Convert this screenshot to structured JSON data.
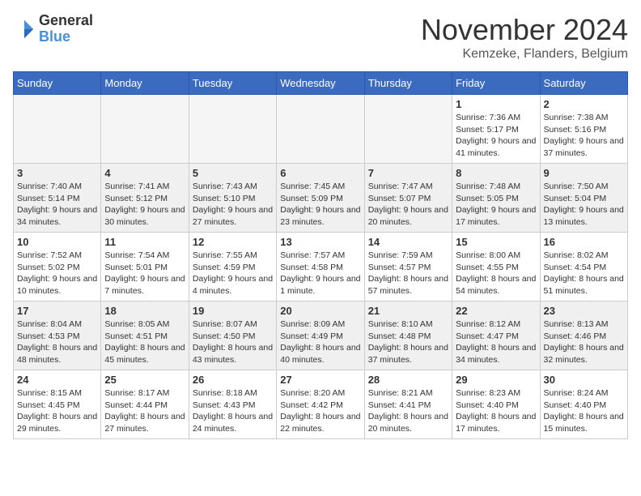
{
  "logo": {
    "general": "General",
    "blue": "Blue"
  },
  "header": {
    "month": "November 2024",
    "location": "Kemzeke, Flanders, Belgium"
  },
  "weekdays": [
    "Sunday",
    "Monday",
    "Tuesday",
    "Wednesday",
    "Thursday",
    "Friday",
    "Saturday"
  ],
  "weeks": [
    [
      {
        "day": "",
        "info": "",
        "empty": true
      },
      {
        "day": "",
        "info": "",
        "empty": true
      },
      {
        "day": "",
        "info": "",
        "empty": true
      },
      {
        "day": "",
        "info": "",
        "empty": true
      },
      {
        "day": "",
        "info": "",
        "empty": true
      },
      {
        "day": "1",
        "info": "Sunrise: 7:36 AM\nSunset: 5:17 PM\nDaylight: 9 hours and 41 minutes."
      },
      {
        "day": "2",
        "info": "Sunrise: 7:38 AM\nSunset: 5:16 PM\nDaylight: 9 hours and 37 minutes."
      }
    ],
    [
      {
        "day": "3",
        "info": "Sunrise: 7:40 AM\nSunset: 5:14 PM\nDaylight: 9 hours and 34 minutes."
      },
      {
        "day": "4",
        "info": "Sunrise: 7:41 AM\nSunset: 5:12 PM\nDaylight: 9 hours and 30 minutes."
      },
      {
        "day": "5",
        "info": "Sunrise: 7:43 AM\nSunset: 5:10 PM\nDaylight: 9 hours and 27 minutes."
      },
      {
        "day": "6",
        "info": "Sunrise: 7:45 AM\nSunset: 5:09 PM\nDaylight: 9 hours and 23 minutes."
      },
      {
        "day": "7",
        "info": "Sunrise: 7:47 AM\nSunset: 5:07 PM\nDaylight: 9 hours and 20 minutes."
      },
      {
        "day": "8",
        "info": "Sunrise: 7:48 AM\nSunset: 5:05 PM\nDaylight: 9 hours and 17 minutes."
      },
      {
        "day": "9",
        "info": "Sunrise: 7:50 AM\nSunset: 5:04 PM\nDaylight: 9 hours and 13 minutes."
      }
    ],
    [
      {
        "day": "10",
        "info": "Sunrise: 7:52 AM\nSunset: 5:02 PM\nDaylight: 9 hours and 10 minutes."
      },
      {
        "day": "11",
        "info": "Sunrise: 7:54 AM\nSunset: 5:01 PM\nDaylight: 9 hours and 7 minutes."
      },
      {
        "day": "12",
        "info": "Sunrise: 7:55 AM\nSunset: 4:59 PM\nDaylight: 9 hours and 4 minutes."
      },
      {
        "day": "13",
        "info": "Sunrise: 7:57 AM\nSunset: 4:58 PM\nDaylight: 9 hours and 1 minute."
      },
      {
        "day": "14",
        "info": "Sunrise: 7:59 AM\nSunset: 4:57 PM\nDaylight: 8 hours and 57 minutes."
      },
      {
        "day": "15",
        "info": "Sunrise: 8:00 AM\nSunset: 4:55 PM\nDaylight: 8 hours and 54 minutes."
      },
      {
        "day": "16",
        "info": "Sunrise: 8:02 AM\nSunset: 4:54 PM\nDaylight: 8 hours and 51 minutes."
      }
    ],
    [
      {
        "day": "17",
        "info": "Sunrise: 8:04 AM\nSunset: 4:53 PM\nDaylight: 8 hours and 48 minutes."
      },
      {
        "day": "18",
        "info": "Sunrise: 8:05 AM\nSunset: 4:51 PM\nDaylight: 8 hours and 45 minutes."
      },
      {
        "day": "19",
        "info": "Sunrise: 8:07 AM\nSunset: 4:50 PM\nDaylight: 8 hours and 43 minutes."
      },
      {
        "day": "20",
        "info": "Sunrise: 8:09 AM\nSunset: 4:49 PM\nDaylight: 8 hours and 40 minutes."
      },
      {
        "day": "21",
        "info": "Sunrise: 8:10 AM\nSunset: 4:48 PM\nDaylight: 8 hours and 37 minutes."
      },
      {
        "day": "22",
        "info": "Sunrise: 8:12 AM\nSunset: 4:47 PM\nDaylight: 8 hours and 34 minutes."
      },
      {
        "day": "23",
        "info": "Sunrise: 8:13 AM\nSunset: 4:46 PM\nDaylight: 8 hours and 32 minutes."
      }
    ],
    [
      {
        "day": "24",
        "info": "Sunrise: 8:15 AM\nSunset: 4:45 PM\nDaylight: 8 hours and 29 minutes."
      },
      {
        "day": "25",
        "info": "Sunrise: 8:17 AM\nSunset: 4:44 PM\nDaylight: 8 hours and 27 minutes."
      },
      {
        "day": "26",
        "info": "Sunrise: 8:18 AM\nSunset: 4:43 PM\nDaylight: 8 hours and 24 minutes."
      },
      {
        "day": "27",
        "info": "Sunrise: 8:20 AM\nSunset: 4:42 PM\nDaylight: 8 hours and 22 minutes."
      },
      {
        "day": "28",
        "info": "Sunrise: 8:21 AM\nSunset: 4:41 PM\nDaylight: 8 hours and 20 minutes."
      },
      {
        "day": "29",
        "info": "Sunrise: 8:23 AM\nSunset: 4:40 PM\nDaylight: 8 hours and 17 minutes."
      },
      {
        "day": "30",
        "info": "Sunrise: 8:24 AM\nSunset: 4:40 PM\nDaylight: 8 hours and 15 minutes."
      }
    ]
  ]
}
